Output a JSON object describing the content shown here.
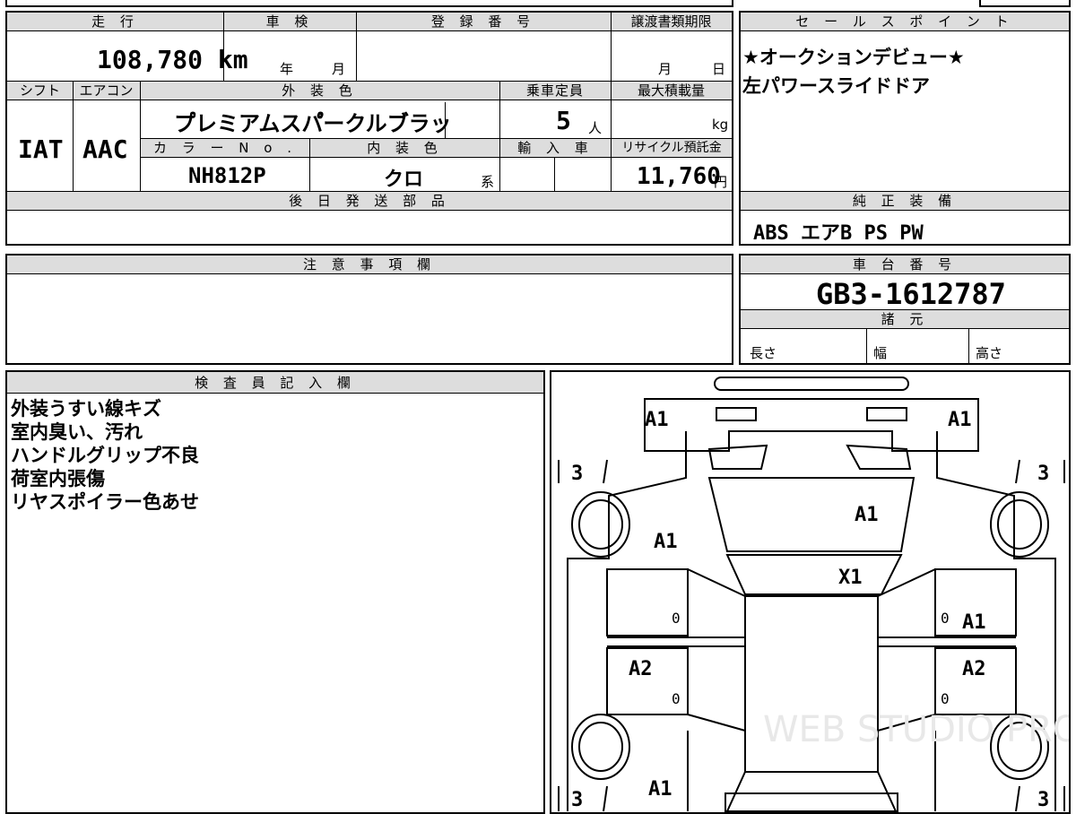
{
  "mileage": {
    "label": "走 行",
    "value": "108,780 km"
  },
  "shaken": {
    "label": "車 検",
    "year_unit": "年",
    "month_unit": "月"
  },
  "registration": {
    "label": "登 録 番 号",
    "value": ""
  },
  "transfer_deadline": {
    "label": "譲渡書類期限",
    "month_unit": "月",
    "day_unit": "日"
  },
  "shift": {
    "label": "シフト",
    "value": "IAT"
  },
  "aircon": {
    "label": "エアコン",
    "value": "AAC"
  },
  "exterior_color": {
    "label": "外 装 色",
    "value": "プ゚レミアムスパ゚ークルブ゙ラッ"
  },
  "capacity": {
    "label": "乗車定員",
    "value": "5",
    "unit": "人"
  },
  "max_load": {
    "label": "最大積載量",
    "unit": "kg"
  },
  "color_no": {
    "label": "カ ラ ー N o .",
    "value": "NH812P"
  },
  "interior_color": {
    "label": "内 装 色",
    "value": "クロ",
    "suffix": "系"
  },
  "import": {
    "label": "輸 入 車"
  },
  "recycle": {
    "label": "リサイクル預託金",
    "value": "11,760",
    "unit": "円"
  },
  "later_parts": {
    "label": "後 日 発 送 部 品"
  },
  "sales_points": {
    "label": "セ ー ル ス ポ イ ン ト",
    "lines": [
      "★オークションデビュー★",
      "左パワースライドドア"
    ]
  },
  "genuine_equipment": {
    "label": "純 正 装 備",
    "value": "ABS エアB PS PW"
  },
  "notes": {
    "label": "注 意 事 項 欄"
  },
  "chassis": {
    "label": "車 台 番 号",
    "value": "GB3-1612787"
  },
  "specs": {
    "label": "諸 元",
    "length": "長さ",
    "width": "幅",
    "height": "高さ"
  },
  "inspector": {
    "label": "検 査 員 記 入 欄",
    "lines": [
      "外装うすい線キズ",
      "室内臭い、汚れ",
      "ハンドルグリップ不良",
      "荷室内張傷",
      "リヤスポイラー色あせ"
    ]
  },
  "diagram": {
    "marks": {
      "front_left": "A1",
      "front_right": "A1",
      "tire_fl": "3",
      "tire_fr": "3",
      "tire_rl": "3",
      "tire_rr": "3",
      "hood": "A1",
      "windshield": "X1",
      "fender_left": "A1",
      "door_right_front": "A1",
      "door_left_rear": "A2",
      "door_right_rear": "A2",
      "rear_left": "A1",
      "door_lf_inner": "0",
      "door_lr_inner": "0",
      "door_rf_inner": "0",
      "door_rr_inner": "0"
    },
    "watermark": "WEB STUDIO PRO"
  }
}
